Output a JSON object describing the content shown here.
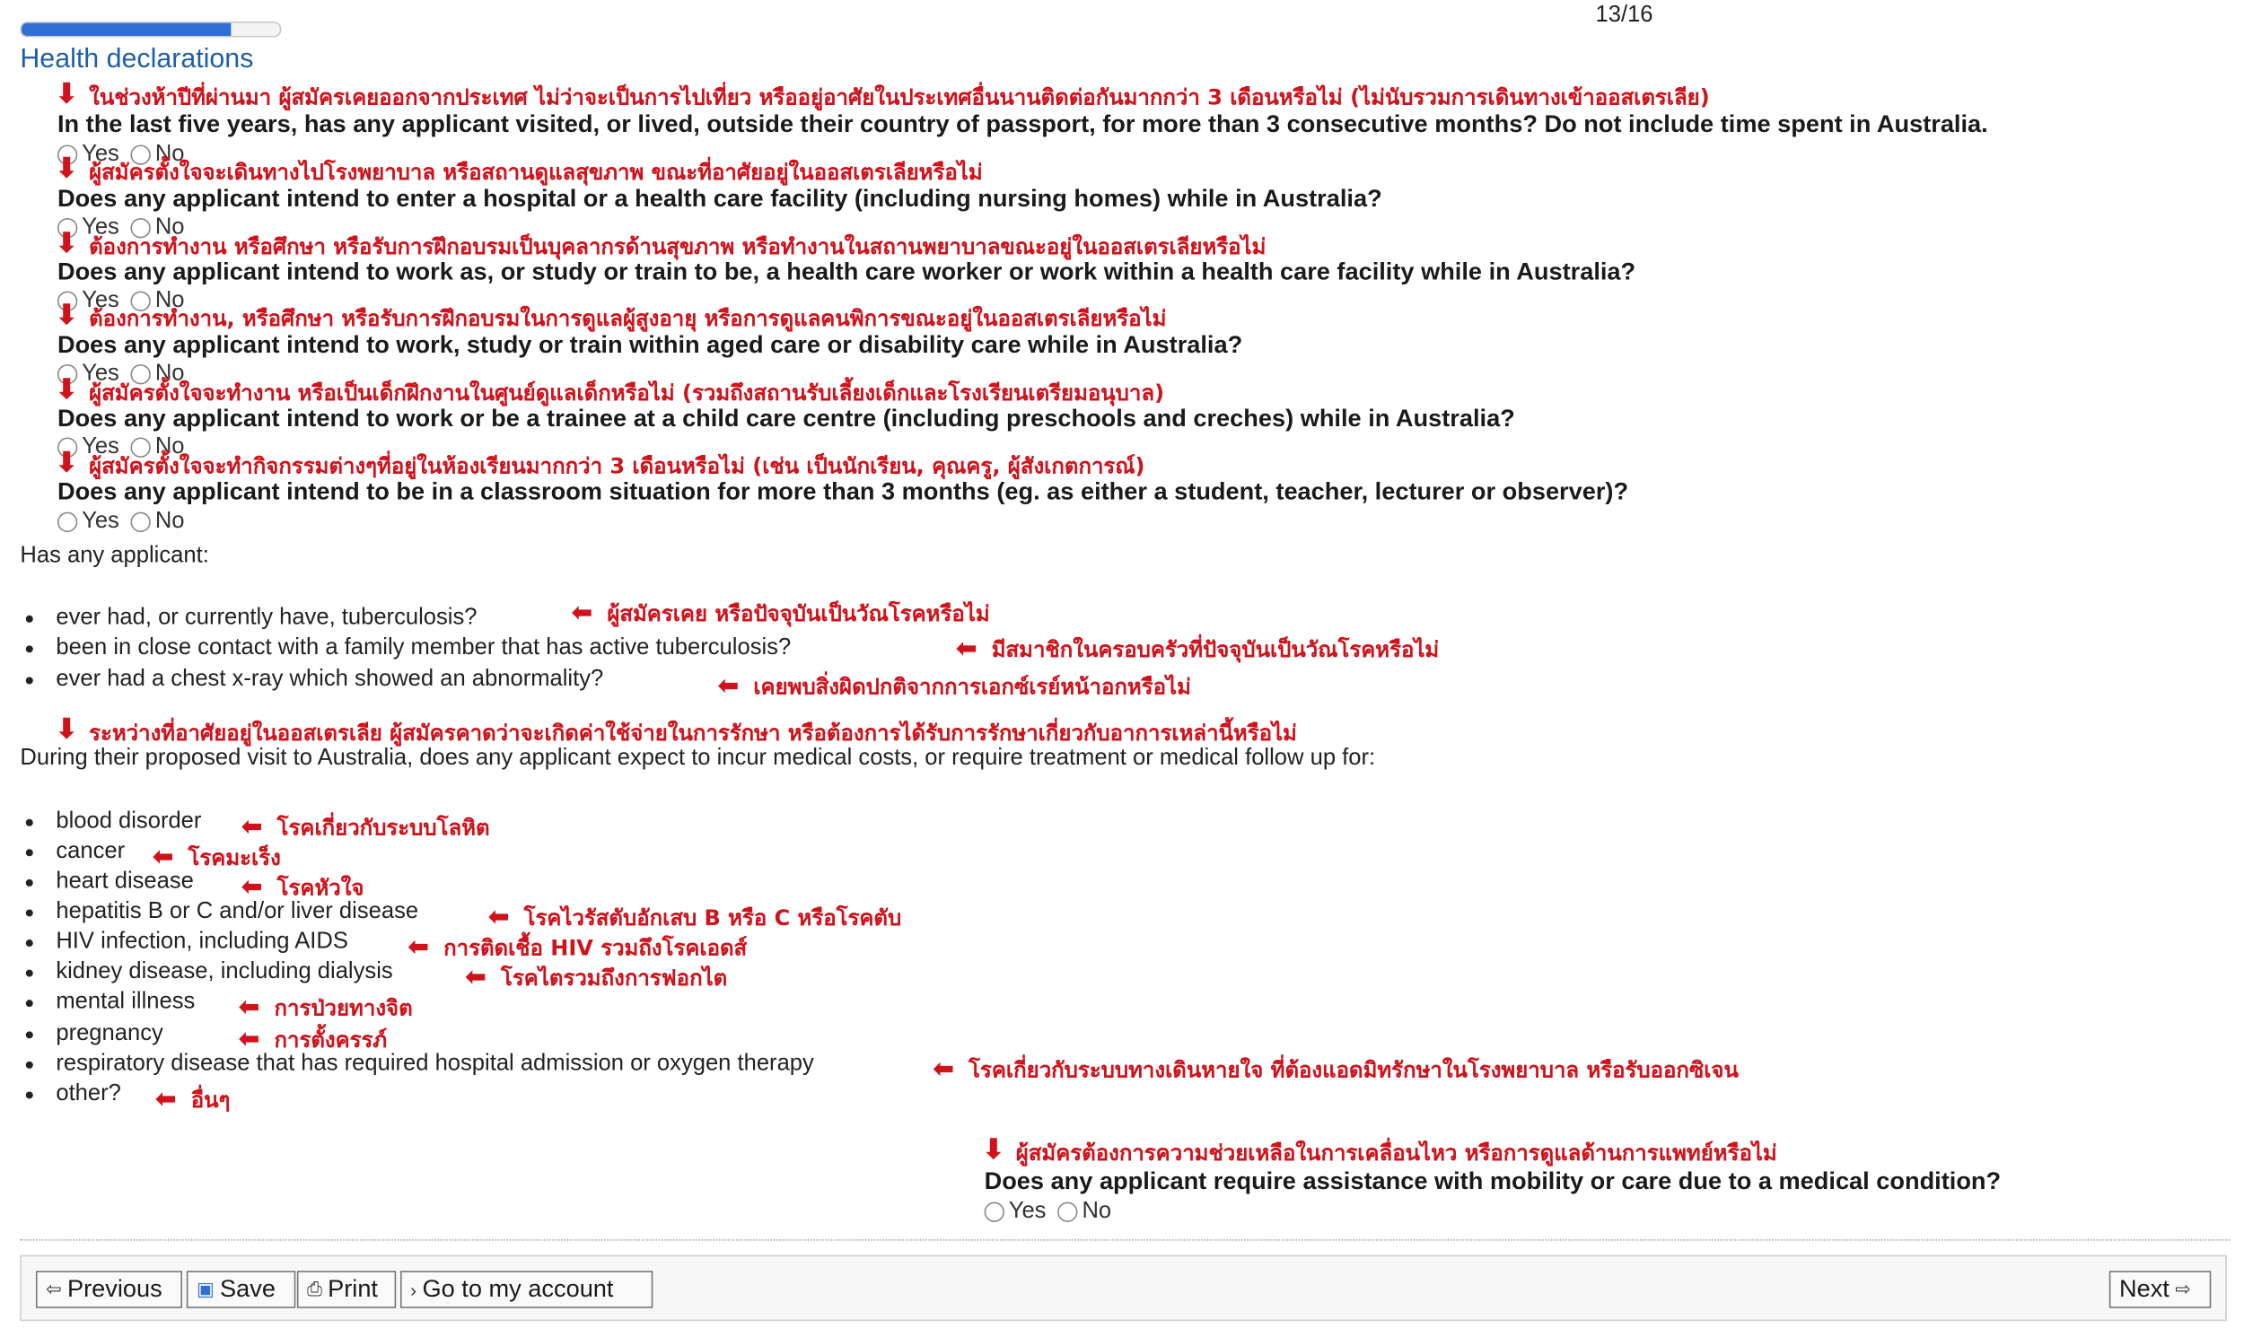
{
  "progress": {
    "step": "13/16",
    "fraction": 0.81
  },
  "section_title": "Health declarations",
  "questions": [
    {
      "thai": "ในช่วงห้าปีที่ผ่านมา ผู้สมัครเคยออกจากประเทศ ไม่ว่าจะเป็นการไปเที่ยว หรืออยู่อาศัยในประเทศอื่นนานติดต่อกันมากกว่า 3 เดือนหรือไม่ (ไม่นับรวมการเดินทางเข้าออสเตรเลีย)",
      "text": "In the last five years, has any applicant visited, or lived, outside their country of passport, for more than 3 consecutive months? Do not include time spent in Australia.",
      "yes": "Yes",
      "no": "No"
    },
    {
      "thai": "ผู้สมัครตั้งใจจะเดินทางไปโรงพยาบาล หรือสถานดูแลสุขภาพ ขณะที่อาศัยอยู่ในออสเตรเลียหรือไม่",
      "text": "Does any applicant intend to enter a hospital or a health care facility (including nursing homes) while in Australia?",
      "yes": "Yes",
      "no": "No"
    },
    {
      "thai": "ต้องการทำงาน หรือศึกษา หรือรับการฝึกอบรมเป็นบุคลากรด้านสุขภาพ หรือทำงานในสถานพยาบาลขณะอยู่ในออสเตรเลียหรือไม่",
      "text": "Does any applicant intend to work as, or study or train to be, a health care worker or work within a health care facility while in Australia?",
      "yes": "Yes",
      "no": "No"
    },
    {
      "thai": "ต้องการทำงาน, หรือศึกษา หรือรับการฝึกอบรมในการดูแลผู้สูงอายุ หรือการดูแลคนพิการขณะอยู่ในออสเตรเลียหรือไม่",
      "text": "Does any applicant intend to work, study or train within aged care or disability care while in Australia?",
      "yes": "Yes",
      "no": "No"
    },
    {
      "thai": "ผู้สมัครตั้งใจจะทำงาน หรือเป็นเด็กฝึกงานในศูนย์ดูแลเด็กหรือไม่ (รวมถึงสถานรับเลี้ยงเด็กและโรงเรียนเตรียมอนุบาล)",
      "text": "Does any applicant intend to work or be a trainee at a child care centre (including preschools and creches) while in Australia?",
      "yes": "Yes",
      "no": "No"
    },
    {
      "thai": "ผู้สมัครตั้งใจจะทำกิจกรรมต่างๆที่อยู่ในห้องเรียนมากกว่า 3 เดือนหรือไม่ (เช่น เป็นนักเรียน, คุณครู, ผู้สังเกตการณ์)",
      "text": "Does any applicant intend to be in a classroom situation for more than 3 months (eg. as either a student, teacher, lecturer or observer)?",
      "yes": "Yes",
      "no": "No"
    }
  ],
  "tb": {
    "intro": "Has any applicant:",
    "items": [
      {
        "text": "ever had, or currently have, tuberculosis?",
        "thai": "ผู้สมัครเคย หรือปัจจุบันเป็นวัณโรคหรือไม่"
      },
      {
        "text": "been in close contact with a family member that has active tuberculosis?",
        "thai": "มีสมาชิกในครอบครัวที่ปัจจุบันเป็นวัณโรคหรือไม่"
      },
      {
        "text": "ever had a chest x-ray which showed an abnormality?",
        "thai": "เคยพบสิ่งผิดปกติจากการเอกซ์เรย์หน้าอกหรือไม่"
      }
    ]
  },
  "medical": {
    "thai": "ระหว่างที่อาศัยอยู่ในออสเตรเลีย ผู้สมัครคาดว่าจะเกิดค่าใช้จ่ายในการรักษา หรือต้องการได้รับการรักษาเกี่ยวกับอาการเหล่านี้หรือไม่",
    "intro": "During their proposed visit to Australia, does any applicant expect to incur medical costs, or require treatment or medical follow up for:",
    "items": [
      {
        "text": "blood disorder",
        "thai": "โรคเกี่ยวกับระบบโลหิต"
      },
      {
        "text": "cancer",
        "thai": "โรคมะเร็ง"
      },
      {
        "text": "heart disease",
        "thai": "โรคหัวใจ"
      },
      {
        "text": "hepatitis B or C and/or liver disease",
        "thai": "โรคไวรัสตับอักเสบ B หรือ C หรือโรคตับ"
      },
      {
        "text": "HIV infection, including AIDS",
        "thai": "การติดเชื้อ HIV รวมถึงโรคเอดส์"
      },
      {
        "text": "kidney disease, including dialysis",
        "thai": "โรคไตรวมถึงการฟอกไต"
      },
      {
        "text": "mental illness",
        "thai": "การป่วยทางจิต"
      },
      {
        "text": "pregnancy",
        "thai": "การตั้งครรภ์"
      },
      {
        "text": "respiratory disease that has required hospital admission or oxygen therapy",
        "thai": "โรคเกี่ยวกับระบบทางเดินหายใจ ที่ต้องแอดมิทรักษาในโรงพยาบาล หรือรับออกซิเจน"
      },
      {
        "text": "other?",
        "thai": "อื่นๆ"
      }
    ]
  },
  "mobility": {
    "thai": "ผู้สมัครต้องการความช่วยเหลือในการเคลื่อนไหว หรือการดูแลด้านการแพทย์หรือไม่",
    "text": "Does any applicant require assistance with mobility or care due to a medical condition?",
    "yes": "Yes",
    "no": "No"
  },
  "nav": {
    "previous": "Previous",
    "save": "Save",
    "print": "Print",
    "account": "Go to my account",
    "next": "Next"
  }
}
